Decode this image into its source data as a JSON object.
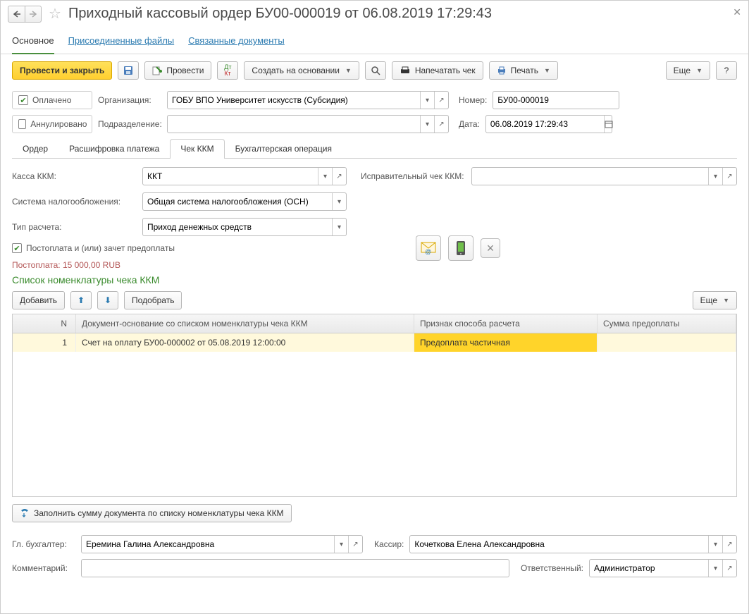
{
  "header": {
    "title": "Приходный кассовый ордер БУ00-000019 от 06.08.2019 17:29:43"
  },
  "top_tabs": {
    "main": "Основное",
    "files": "Присоединенные файлы",
    "linked": "Связанные документы"
  },
  "toolbar": {
    "post_close": "Провести и закрыть",
    "post": "Провести",
    "create_based": "Создать на основании",
    "print_check": "Напечатать чек",
    "print": "Печать",
    "more": "Еще"
  },
  "status": {
    "paid_label": "Оплачено",
    "cancelled_label": "Аннулировано"
  },
  "header_fields": {
    "org_label": "Организация:",
    "org_value": "ГОБУ ВПО Университет искусств (Субсидия)",
    "subdiv_label": "Подразделение:",
    "subdiv_value": "",
    "number_label": "Номер:",
    "number_value": "БУ00-000019",
    "date_label": "Дата:",
    "date_value": "06.08.2019 17:29:43"
  },
  "inner_tabs": {
    "order": "Ордер",
    "decoding": "Расшифровка платежа",
    "check": "Чек ККМ",
    "accounting": "Бухгалтерская операция"
  },
  "check_tab": {
    "kkm_label": "Касса ККМ:",
    "kkm_value": "ККТ",
    "corr_check_label": "Исправительный чек ККМ:",
    "corr_check_value": "",
    "tax_sys_label": "Система налогообложения:",
    "tax_sys_value": "Общая система налогообложения (ОСН)",
    "calc_type_label": "Тип расчета:",
    "calc_type_value": "Приход денежных средств",
    "postpay_check": "Постоплата и (или) зачет предоплаты",
    "postpay_text": "Постоплата: 15 000,00 RUB",
    "list_title": "Список номенклатуры чека ККМ",
    "add_btn": "Добавить",
    "pick_btn": "Подобрать",
    "more_btn": "Еще",
    "fill_btn": "Заполнить сумму документа по списку номенклатуры чека ККМ"
  },
  "grid": {
    "cols": {
      "n": "N",
      "doc": "Документ-основание со списком номенклатуры чека ККМ",
      "sign": "Признак способа расчета",
      "sum": "Сумма предоплаты"
    },
    "rows": [
      {
        "n": "1",
        "doc": "Счет на оплату БУ00-000002 от 05.08.2019 12:00:00",
        "sign": "Предоплата частичная",
        "sum": ""
      }
    ]
  },
  "footer": {
    "chief_acc_label": "Гл. бухгалтер:",
    "chief_acc_value": "Еремина Галина Александровна",
    "cashier_label": "Кассир:",
    "cashier_value": "Кочеткова Елена Александровна",
    "comment_label": "Комментарий:",
    "comment_value": "",
    "responsible_label": "Ответственный:",
    "responsible_value": "Администратор"
  }
}
